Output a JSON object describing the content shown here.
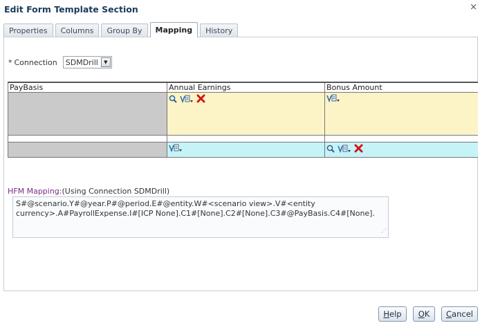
{
  "dialog": {
    "title": "Edit Form Template Section",
    "close": "×"
  },
  "tabs": [
    {
      "label": "Properties",
      "active": false
    },
    {
      "label": "Columns",
      "active": false
    },
    {
      "label": "Group By",
      "active": false
    },
    {
      "label": "Mapping",
      "active": true
    },
    {
      "label": "History",
      "active": false
    }
  ],
  "connection": {
    "required_mark": "*",
    "label": "Connection",
    "value": "SDMDrill",
    "arrow": "▼"
  },
  "grid": {
    "headers": [
      "PayBasis",
      "Annual Earnings",
      "Bonus Amount"
    ],
    "colors": {
      "gray": "#cacaca",
      "yellow": "#fcf4c6",
      "cyan": "#c5f3f8"
    }
  },
  "hfm": {
    "label": "HFM Mapping:",
    "connection_note": "(Using Connection SDMDrill)",
    "text": "S#@scenario.Y#@year.P#@period.E#@entity.W#<scenario view>.V#<entity currency>.A#PayrollExpense.I#[ICP None].C1#[None].C2#[None].C3#@PayBasis.C4#[None]."
  },
  "buttons": {
    "help": {
      "mnemonic": "H",
      "rest": "elp"
    },
    "ok": {
      "mnemonic": "O",
      "rest": "K"
    },
    "cancel": {
      "mnemonic": "C",
      "rest": "ancel"
    }
  }
}
